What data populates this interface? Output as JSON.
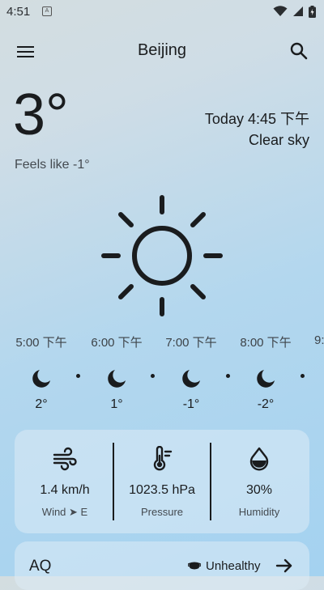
{
  "status_bar": {
    "time": "4:51",
    "notification_letter": "A"
  },
  "app_bar": {
    "title": "Beijing"
  },
  "current": {
    "temperature": "3°",
    "datetime": "Today 4:45 下午",
    "description": "Clear sky",
    "feels_like": "Feels like -1°"
  },
  "hourly": [
    {
      "time": "5:00 下午",
      "temp": "2°",
      "icon": "moon-icon"
    },
    {
      "time": "6:00 下午",
      "temp": "1°",
      "icon": "moon-icon"
    },
    {
      "time": "7:00 下午",
      "temp": "-1°",
      "icon": "moon-icon"
    },
    {
      "time": "8:00 下午",
      "temp": "-2°",
      "icon": "moon-icon"
    },
    {
      "time": "9:",
      "temp": "",
      "icon": ""
    }
  ],
  "details": {
    "wind": {
      "value": "1.4 km/h",
      "label": "Wind ➤ E",
      "icon": "wind-icon"
    },
    "pressure": {
      "value": "1023.5 hPa",
      "label": "Pressure",
      "icon": "thermometer-icon"
    },
    "humidity": {
      "value": "30%",
      "label": "Humidity",
      "icon": "water-drop-icon"
    }
  },
  "aq": {
    "title": "AQ",
    "status": "Unhealthy"
  }
}
